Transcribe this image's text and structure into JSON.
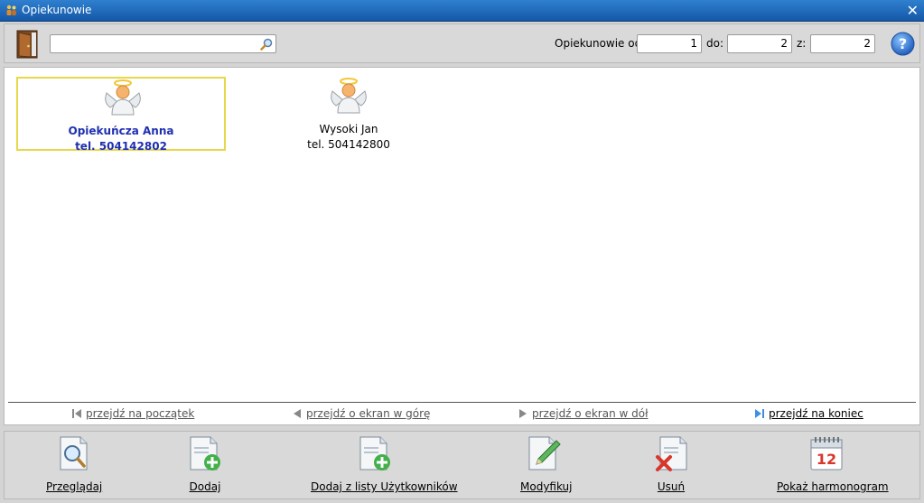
{
  "window": {
    "title": "Opiekunowie",
    "close_symbol": "✕"
  },
  "toolbar": {
    "search": {
      "value": "",
      "placeholder": ""
    },
    "range_label_from": "Opiekunowie od:",
    "range_from": "1",
    "range_label_to": "do:",
    "range_to": "2",
    "range_label_total": "z:",
    "range_total": "2",
    "help_symbol": "?"
  },
  "caregivers": [
    {
      "name": "Opiekuńcza Anna",
      "phone": "tel.  504142802",
      "selected": true
    },
    {
      "name": "Wysoki Jan",
      "phone": "tel.  504142800",
      "selected": false
    }
  ],
  "pager": {
    "first": "przejdź na początek",
    "up": "przejdź o ekran w górę",
    "down": "przejdź o ekran w dół",
    "last": "przejdź na koniec"
  },
  "buttons": {
    "browse": "Przeglądaj",
    "add": "Dodaj",
    "add_from_users": "Dodaj z listy Użytkowników",
    "modify": "Modyfikuj",
    "delete": "Usuń",
    "schedule": "Pokaż harmonogram",
    "calendar_day": "12"
  },
  "icons": {
    "app": "people-icon",
    "exit": "door-icon",
    "search": "magnifier-icon",
    "help": "help-icon",
    "caregiver": "angel-icon",
    "browse": "document-magnifier-icon",
    "add": "document-add-icon",
    "add_from_users": "document-add-icon",
    "modify": "document-pencil-icon",
    "delete": "document-delete-icon",
    "schedule": "calendar-icon"
  },
  "colors": {
    "title_bar": "#1d63b5",
    "selected_border": "#e6d84a",
    "selected_text": "#1e2fb0"
  }
}
